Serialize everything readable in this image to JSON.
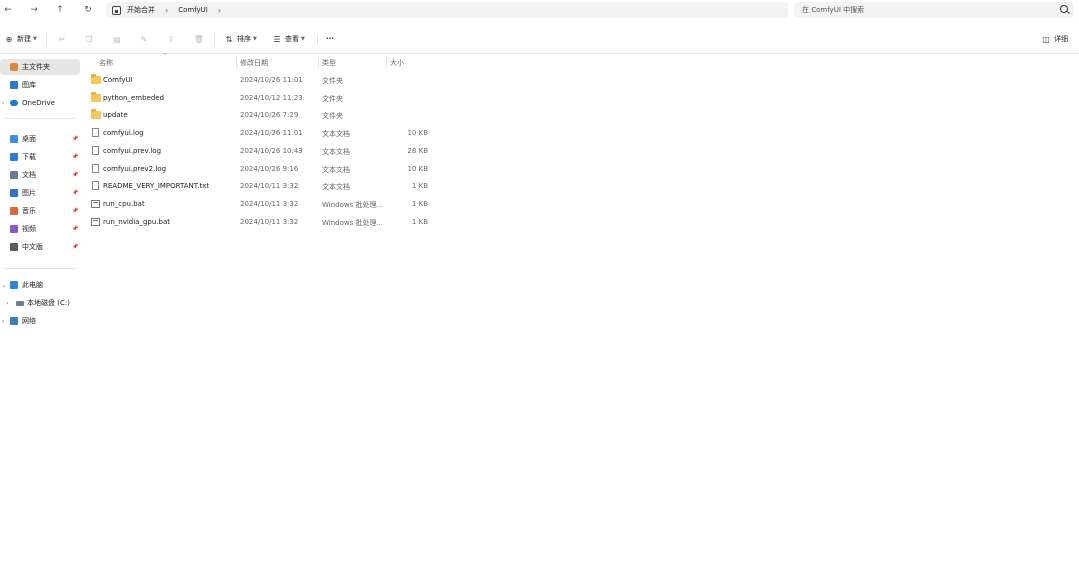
{
  "nav": {
    "back_icon": "arrow-left-icon",
    "forward_icon": "arrow-right-icon",
    "up_icon": "arrow-up-icon",
    "refresh_icon": "refresh-icon"
  },
  "address": {
    "home_label": "开始合并",
    "current_folder": "ComfyUI"
  },
  "search": {
    "placeholder": "在 ComfyUI 中搜索"
  },
  "toolbar": {
    "new_label": "新建",
    "sort_label": "排序",
    "view_label": "查看",
    "more_label": "···",
    "details_label": "详细"
  },
  "sidebar": {
    "home": "主文件夹",
    "gallery": "图库",
    "onedrive": "OneDrive",
    "quick": [
      {
        "label": "桌面",
        "color": "#3a8ee6"
      },
      {
        "label": "下载",
        "color": "#2a7fd4"
      },
      {
        "label": "文档",
        "color": "#6b7a8c"
      },
      {
        "label": "图片",
        "color": "#2f6fd0"
      },
      {
        "label": "音乐",
        "color": "#d9683a"
      },
      {
        "label": "视频",
        "color": "#8a57c9"
      },
      {
        "label": "中文版",
        "color": "#5c5c5c"
      }
    ],
    "this_pc": "此电脑",
    "local_disk": "本地磁盘 (C:)",
    "network": "网络"
  },
  "columns": {
    "name": "名称",
    "date": "修改日期",
    "type": "类型",
    "size": "大小"
  },
  "files": [
    {
      "name": "ComfyUI",
      "date": "2024/10/26 11:01",
      "type": "文件夹",
      "size": "",
      "kind": "folder"
    },
    {
      "name": "python_embeded",
      "date": "2024/10/12 11:23",
      "type": "文件夹",
      "size": "",
      "kind": "folder"
    },
    {
      "name": "update",
      "date": "2024/10/26 7:29",
      "type": "文件夹",
      "size": "",
      "kind": "folder"
    },
    {
      "name": "comfyui.log",
      "date": "2024/10/26 11:01",
      "type": "文本文档",
      "size": "10 KB",
      "kind": "file"
    },
    {
      "name": "comfyui.prev.log",
      "date": "2024/10/26 10:43",
      "type": "文本文档",
      "size": "28 KB",
      "kind": "file"
    },
    {
      "name": "comfyui.prev2.log",
      "date": "2024/10/26 9:16",
      "type": "文本文档",
      "size": "10 KB",
      "kind": "file"
    },
    {
      "name": "README_VERY_IMPORTANT.txt",
      "date": "2024/10/11 3:32",
      "type": "文本文档",
      "size": "1 KB",
      "kind": "file"
    },
    {
      "name": "run_cpu.bat",
      "date": "2024/10/11 3:32",
      "type": "Windows 批处理...",
      "size": "1 KB",
      "kind": "bat"
    },
    {
      "name": "run_nvidia_gpu.bat",
      "date": "2024/10/11 3:32",
      "type": "Windows 批处理...",
      "size": "1 KB",
      "kind": "bat"
    }
  ]
}
